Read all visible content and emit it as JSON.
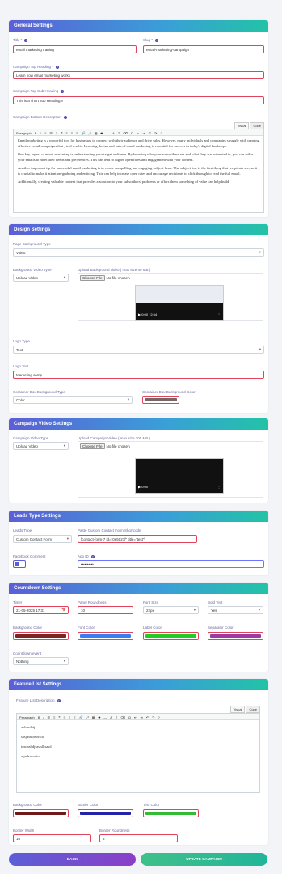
{
  "general": {
    "title": "General Settings",
    "title_label": "Title *",
    "title_value": "email marketing traning",
    "slug_label": "Slug *",
    "slug_value": "email-marketing-campaign",
    "top_heading_label": "Campaign Top Heading *",
    "top_heading_value": "Learn how email marketing works",
    "top_sub_label": "Campaign Top Sub Heading",
    "top_sub_value": "This is a short sub Heading!!!",
    "bottom_desc_label": "Campaign Bottom Description",
    "tab_visual": "Visual",
    "tab_code": "Code",
    "paragraph": "Paragraph",
    "p1": "Email marketing is a powerful tool for businesses to connect with their audience and drive sales. However, many individuals and companies struggle with creating effective email campaigns that yield results. Learning the ins and outs of email marketing is essential for success in today's digital landscape.",
    "p2": "One key aspect of email marketing is understanding your target audience. By knowing who your subscribers are and what they are interested in, you can tailor your emails to meet their needs and preferences. This can lead to higher open rates and engagement with your content.",
    "p3": "Another important tip for successful email marketing is to create compelling and engaging subject lines. The subject line is the first thing that recipients see, so it is crucial to make it attention-grabbing and enticing. This can help increase open rates and encourage recipients to click through to read the full email.",
    "p4": "Additionally, creating valuable content that provides a solution to your subscribers' problems or offers them something of value can help build"
  },
  "design": {
    "title": "Design Settings",
    "bg_type_label": "Page Background Type",
    "bg_type_value": "Video",
    "bg_video_type_label": "Background Video Type",
    "bg_video_type_value": "Upload Video",
    "upload_bg_label": "Upload Background video ( max size 40 MB )",
    "choose_file": "Choose File",
    "no_file": "No file chosen",
    "video_time": "0:00 / 2:54",
    "logo_type_label": "Logo Type",
    "logo_type_value": "Text",
    "logo_text_label": "Logo Text",
    "logo_text_value": "Marketing camp",
    "container_bg_type_label": "Container Box Background Type",
    "container_bg_type_value": "Color",
    "container_bg_color_label": "Container Box Background Color",
    "container_bg_color": "#7a6464"
  },
  "campaign_video": {
    "title": "Campaign Video Settings",
    "type_label": "Campaign Video Type",
    "type_value": "Upload Video",
    "upload_label": "Upload Campaign Video ( max size 100 MB )",
    "choose_file": "Choose File",
    "no_file": "No file chosen",
    "video_time": "0:00"
  },
  "leads": {
    "title": "Leads Type Settings",
    "type_label": "Leads Type",
    "type_value": "Custom Contact Form",
    "shortcode_label": "Paste Custom Contact Form Shortcode",
    "shortcode_value": "[contact-form-7 id=\"0e5027f\" title=\"test\"]",
    "fb_label": "Facebook Comment",
    "app_id_label": "App ID",
    "app_id_value": "••••••••••"
  },
  "countdown": {
    "title": "Countdown Settings",
    "timer_label": "Timer",
    "timer_value": "21-05-2025 17:31",
    "roundness_label": "Panel Roundness",
    "roundness_value": "10",
    "font_size_label": "Font Size",
    "font_size_value": "22px",
    "bold_label": "Bold Text",
    "bold_value": "Yes",
    "bg_color_label": "Background Color",
    "bg_color": "#7a2424",
    "font_color_label": "Font Color",
    "font_color": "#3a7df0",
    "label_color_label": "Label Color",
    "label_color": "#22cc22",
    "sep_color_label": "Separator Color",
    "sep_color": "#a03aa0",
    "event_label": "Countdown event",
    "event_value": "Nothing"
  },
  "features": {
    "title": "Feature List Settings",
    "desc_label": "Feature List Description",
    "tab_visual": "Visual",
    "tab_code": "Code",
    "paragraph": "Paragraph",
    "items": [
      "akbasdaij",
      "sasjddsjhsofsfa",
      "iosdashdjsaslslksasd",
      "aijadsasodio"
    ],
    "bg_color_label": "Background Color",
    "bg_color": "#6e1a1a",
    "border_color_label": "Border Color",
    "border_color": "#2222aa",
    "text_color_label": "Text Color",
    "text_color": "#33bb33",
    "border_width_label": "Border Width",
    "border_width_value": "16",
    "border_round_label": "Border Roundness",
    "border_round_value": "3"
  },
  "actions": {
    "back": "BACK",
    "update": "UPDATE CAMPAIGN"
  }
}
